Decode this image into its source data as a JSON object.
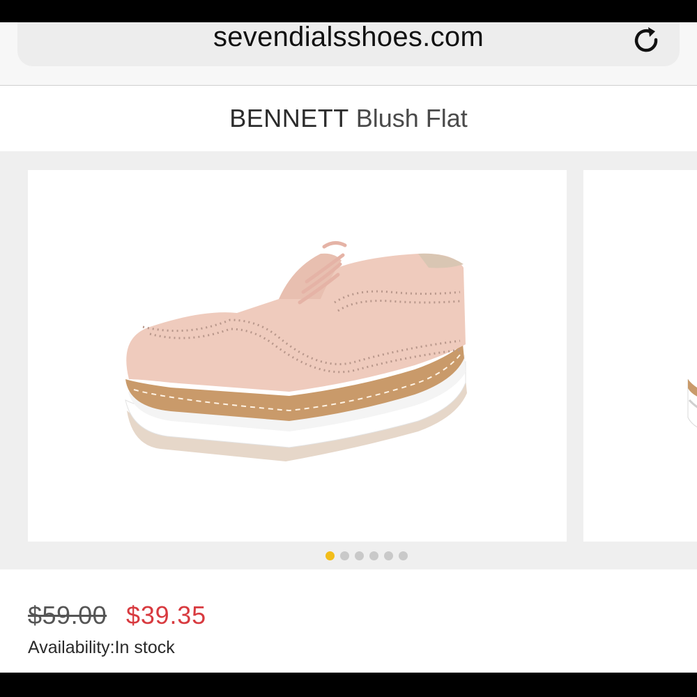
{
  "browser": {
    "url": "sevendialsshoes.com",
    "reload_icon": "reload-icon"
  },
  "product": {
    "brand": "BENNETT",
    "name": "Blush Flat",
    "image_icon": "shoe-image",
    "gallery": {
      "dot_count": 6,
      "active_index": 0
    },
    "price": {
      "original": "$59.00",
      "sale": "$39.35"
    },
    "availability": "Availability:In stock"
  },
  "colors": {
    "accent_dot": "#f2bd1a",
    "sale_price": "#d83a3f",
    "shoe_upper": "#efcbbd",
    "sole_tan": "#c99a6a"
  }
}
